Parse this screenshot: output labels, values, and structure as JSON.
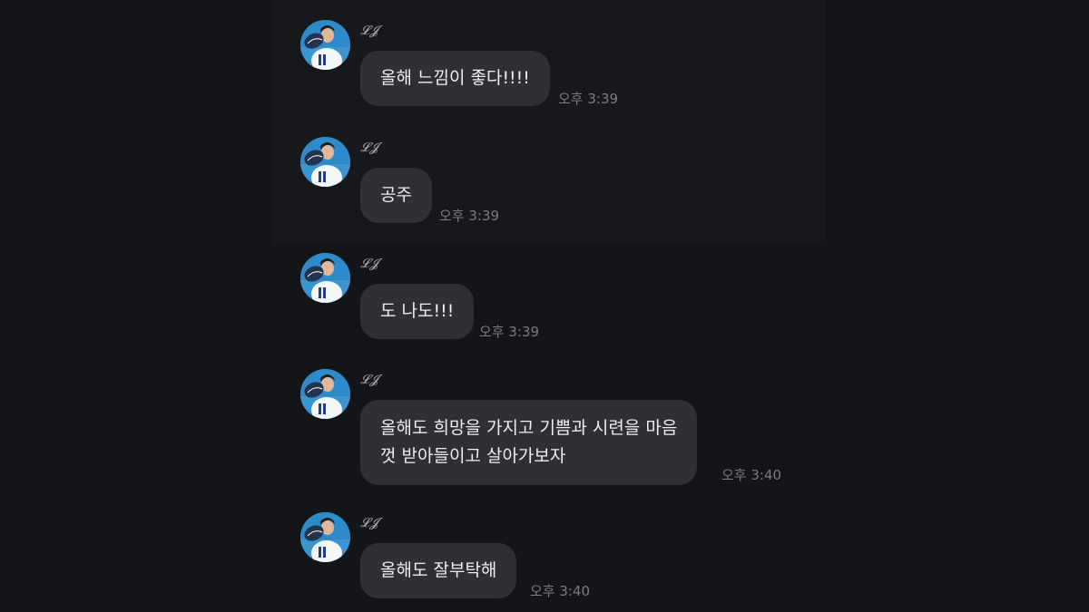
{
  "chat": {
    "messages": [
      {
        "sender": "𝓛𝓙",
        "text": "올해 느낌이 좋다!!!!",
        "time": "오후 3:39"
      },
      {
        "sender": "𝓛𝓙",
        "text": "공주",
        "time": "오후 3:39"
      },
      {
        "sender": "𝓛𝓙",
        "text": "도 나도!!!",
        "time": "오후 3:39"
      },
      {
        "sender": "𝓛𝓙",
        "lines": [
          "올해도 희망을 가지고 기쁨과 시련을 마음",
          "껏 받아들이고 살아가보자"
        ],
        "time": "오후 3:40"
      },
      {
        "sender": "𝓛𝓙",
        "text": "올해도 잘부탁해",
        "time": "오후 3:40"
      }
    ]
  },
  "icons": {
    "avatar": "profile-photo-avatar"
  },
  "colors": {
    "background": "#141519",
    "bubble": "#2f3036",
    "text": "#eceef1",
    "time": "#7a7c83"
  }
}
